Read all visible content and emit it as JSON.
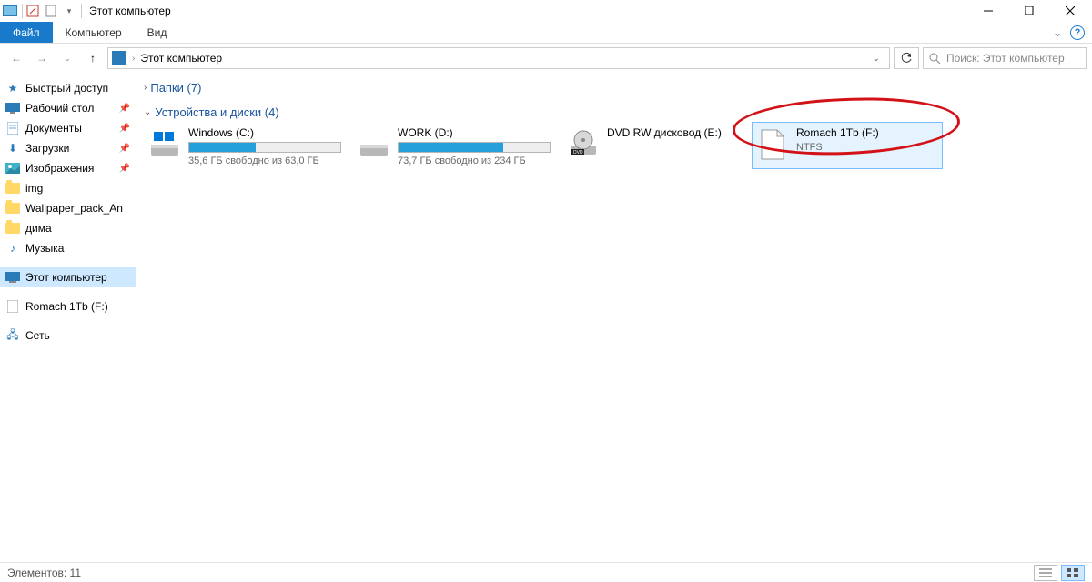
{
  "window": {
    "title": "Этот компьютер"
  },
  "ribbon": {
    "file": "Файл",
    "tabs": [
      "Компьютер",
      "Вид"
    ]
  },
  "breadcrumb": {
    "location": "Этот компьютер"
  },
  "search": {
    "placeholder": "Поиск: Этот компьютер"
  },
  "sidebar": {
    "quick": {
      "label": "Быстрый доступ"
    },
    "items": [
      {
        "label": "Рабочий стол",
        "pinned": true
      },
      {
        "label": "Документы",
        "pinned": true
      },
      {
        "label": "Загрузки",
        "pinned": true
      },
      {
        "label": "Изображения",
        "pinned": true
      },
      {
        "label": "img",
        "pinned": false
      },
      {
        "label": "Wallpaper_pack_An",
        "pinned": false
      },
      {
        "label": "дима",
        "pinned": false
      },
      {
        "label": "Музыка",
        "pinned": false
      }
    ],
    "this_pc": {
      "label": "Этот компьютер"
    },
    "drive_f": {
      "label": "Romach 1Tb (F:)"
    },
    "network": {
      "label": "Сеть"
    }
  },
  "sections": {
    "folders": {
      "title": "Папки (7)"
    },
    "drives": {
      "title": "Устройства и диски (4)"
    }
  },
  "drives": [
    {
      "name": "Windows (C:)",
      "free_text": "35,6 ГБ свободно из 63,0 ГБ",
      "fill_pct": 44,
      "kind": "disk"
    },
    {
      "name": "WORK (D:)",
      "free_text": "73,7 ГБ свободно из 234 ГБ",
      "fill_pct": 69,
      "kind": "disk"
    },
    {
      "name": "DVD RW дисковод (E:)",
      "free_text": "",
      "fill_pct": null,
      "kind": "dvd"
    },
    {
      "name": "Romach 1Tb (F:)",
      "free_text": "NTFS",
      "fill_pct": null,
      "kind": "blank",
      "selected": true
    }
  ],
  "status": {
    "text": "Элементов: 11"
  }
}
